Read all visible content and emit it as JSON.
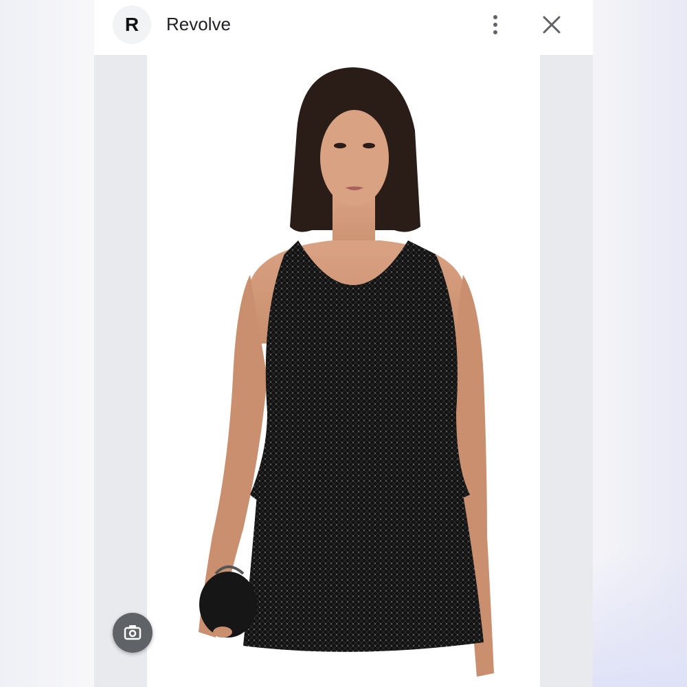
{
  "header": {
    "site_initial": "R",
    "site_name": "Revolve",
    "more_icon": "more-vertical-icon",
    "close_icon": "close-icon"
  },
  "product_image": {
    "subject": "model-wearing-sequin-halter-top",
    "icon": "photo"
  },
  "lens_button": {
    "icon": "camera-lens-icon"
  },
  "colors": {
    "header_bg": "#ffffff",
    "text": "#202124",
    "icon": "#5f6368",
    "gutter": "#e9eaee",
    "garment": "#141414"
  }
}
